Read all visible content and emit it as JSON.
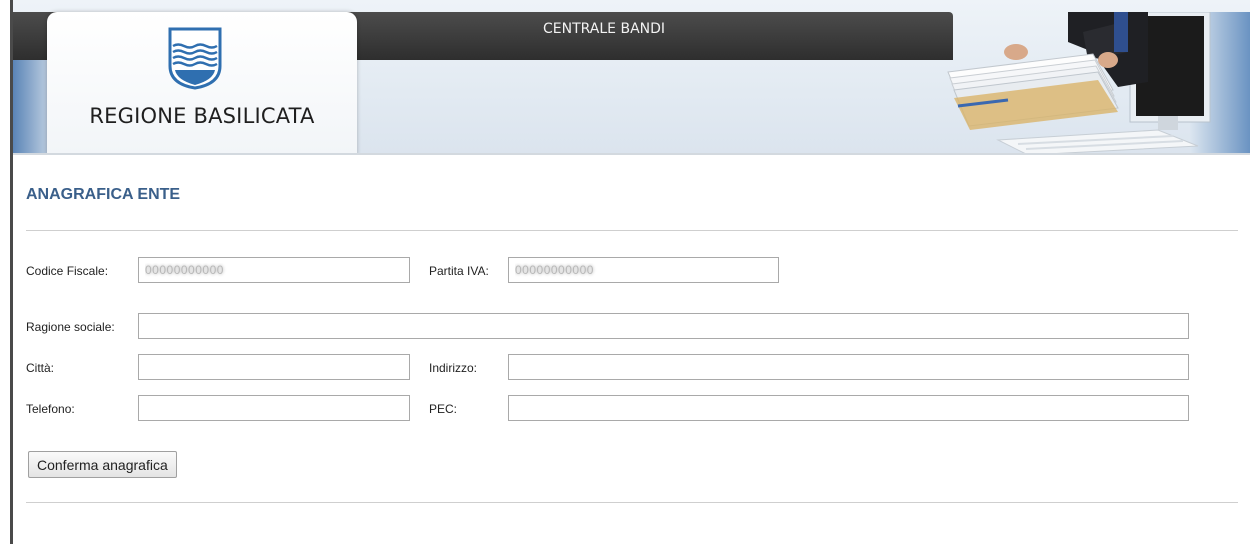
{
  "header": {
    "brand_name": "REGIONE BASILICATA",
    "app_title": "CENTRALE BANDI",
    "crest_icon": "regione-basilicata-crest",
    "illustration_icon": "documents-handover-illustration"
  },
  "section": {
    "title": "ANAGRAFICA ENTE"
  },
  "form": {
    "codice_fiscale": {
      "label": "Codice Fiscale:",
      "value": "00000000000"
    },
    "partita_iva": {
      "label": "Partita IVA:",
      "value": "00000000000"
    },
    "ragione_sociale": {
      "label": "Ragione sociale:",
      "value": ""
    },
    "citta": {
      "label": "Città:",
      "value": ""
    },
    "indirizzo": {
      "label": "Indirizzo:",
      "value": ""
    },
    "telefono": {
      "label": "Telefono:",
      "value": ""
    },
    "pec": {
      "label": "PEC:",
      "value": ""
    },
    "submit_label": "Conferma anagrafica"
  },
  "colors": {
    "section_title": "#3a5f8a",
    "header_dark": "#3a3a3a",
    "crest_blue": "#2f6fb0"
  }
}
